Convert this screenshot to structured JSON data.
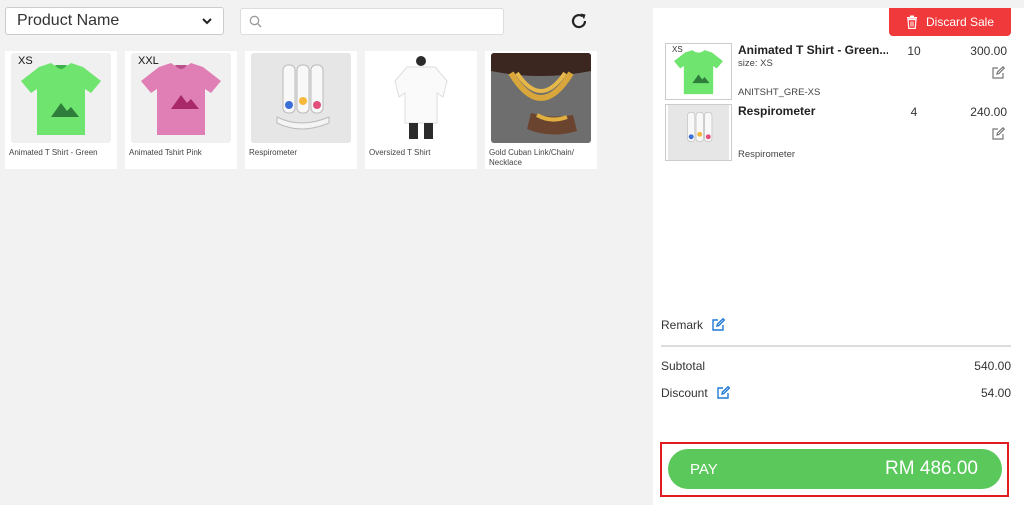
{
  "filter": {
    "selected": "Product Name"
  },
  "search": {
    "placeholder": ""
  },
  "products": [
    {
      "name": "Animated T Shirt - Green",
      "tag": "XS"
    },
    {
      "name": "Animated Tshirt Pink",
      "tag": "XXL"
    },
    {
      "name": "Respirometer",
      "tag": ""
    },
    {
      "name": "Oversized T Shirt",
      "tag": ""
    },
    {
      "name": "Gold Cuban Link/Chain/ Necklace",
      "tag": ""
    }
  ],
  "cart": {
    "discard_label": "Discard Sale",
    "items": [
      {
        "title": "Animated T Shirt - Green...",
        "qty": "10",
        "price": "300.00",
        "tag": "XS",
        "size": "size: XS",
        "sku": "ANITSHT_GRE-XS"
      },
      {
        "title": "Respirometer",
        "qty": "4",
        "price": "240.00",
        "tag": "",
        "size": "",
        "sku": "Respirometer"
      }
    ],
    "remark_label": "Remark",
    "subtotal_label": "Subtotal",
    "subtotal_value": "540.00",
    "discount_label": "Discount",
    "discount_value": "54.00",
    "pay_label": "PAY",
    "pay_amount": "RM 486.00"
  },
  "colors": {
    "pay": "#5ac85a",
    "discard": "#f0393a",
    "highlight": "#e01b22",
    "edit_blue": "#1f7ad6"
  }
}
